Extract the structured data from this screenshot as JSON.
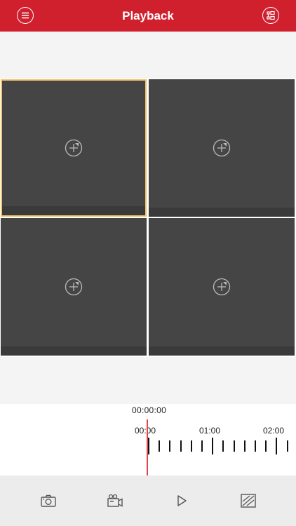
{
  "header": {
    "title": "Playback",
    "menu_icon": "menu-icon",
    "channel_list_icon": "channel-list-icon",
    "accent_color": "#d0202e"
  },
  "grid": {
    "cells": [
      {
        "state": "selected",
        "icon": "add-channel-icon"
      },
      {
        "state": "empty",
        "icon": "add-channel-icon"
      },
      {
        "state": "empty",
        "icon": "add-channel-icon"
      },
      {
        "state": "empty",
        "icon": "add-channel-icon"
      }
    ],
    "selected_border_color": "#f2c46b"
  },
  "timeline": {
    "current_time": "00:00:00",
    "labels": [
      "00:00",
      "01:00",
      "02:00"
    ],
    "cursor_color": "#e04848"
  },
  "toolbar": {
    "items": [
      "camera-snapshot-icon",
      "record-video-icon",
      "play-icon",
      "screen-ratio-icon"
    ]
  }
}
